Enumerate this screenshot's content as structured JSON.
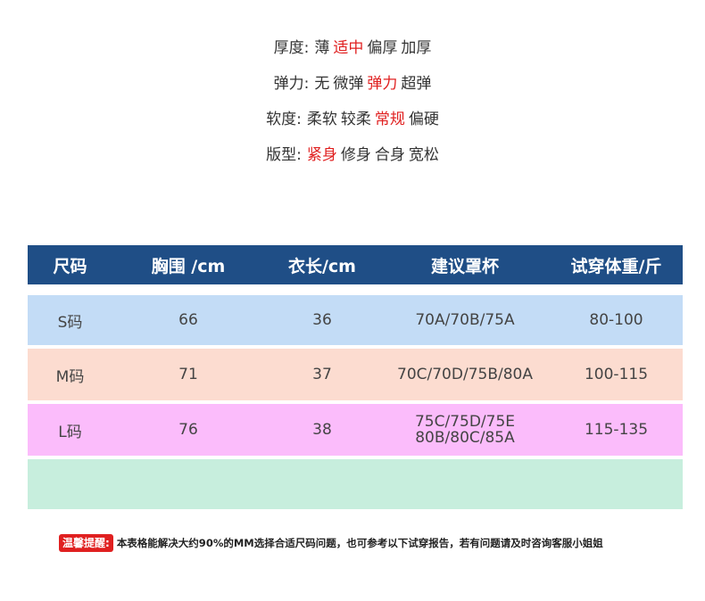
{
  "attributes": [
    {
      "label": "厚度:",
      "options": [
        "薄",
        "适中",
        "偏厚",
        "加厚"
      ],
      "selected": "适中"
    },
    {
      "label": "弹力:",
      "options": [
        "无",
        "微弹",
        "弹力",
        "超弹"
      ],
      "selected": "弹力"
    },
    {
      "label": "软度:",
      "options": [
        "柔软",
        "较柔",
        "常规",
        "偏硬"
      ],
      "selected": "常规"
    },
    {
      "label": "版型:",
      "options": [
        "紧身",
        "修身",
        "合身",
        "宽松"
      ],
      "selected": "紧身"
    }
  ],
  "table": {
    "headers": [
      "尺码",
      "胸围 /cm",
      "衣长/cm",
      "建议罩杯",
      "试穿体重/斤"
    ],
    "rows": [
      {
        "size": "S码",
        "bust": "66",
        "length": "36",
        "cup": [
          "70A/70B/75A"
        ],
        "weight": "80-100",
        "color": "#c3dcf6"
      },
      {
        "size": "M码",
        "bust": "71",
        "length": "37",
        "cup": [
          "70C/70D/75B/80A"
        ],
        "weight": "100-115",
        "color": "#fcdcd0"
      },
      {
        "size": "L码",
        "bust": "76",
        "length": "38",
        "cup": [
          "75C/75D/75E",
          "80B/80C/85A"
        ],
        "weight": "115-135",
        "color": "#fbbcfb"
      },
      {
        "size": "",
        "bust": "",
        "length": "",
        "cup": [],
        "weight": "",
        "color": "#c7eedd"
      }
    ]
  },
  "tip": {
    "badge": "温馨提醒:",
    "text": "本表格能解决大约90%的MM选择合适尺码问题，也可参考以下试穿报告，若有问题请及时咨询客服小姐姐"
  },
  "colors": {
    "header_bg": "#1f4e86",
    "selected": "#e02020"
  }
}
